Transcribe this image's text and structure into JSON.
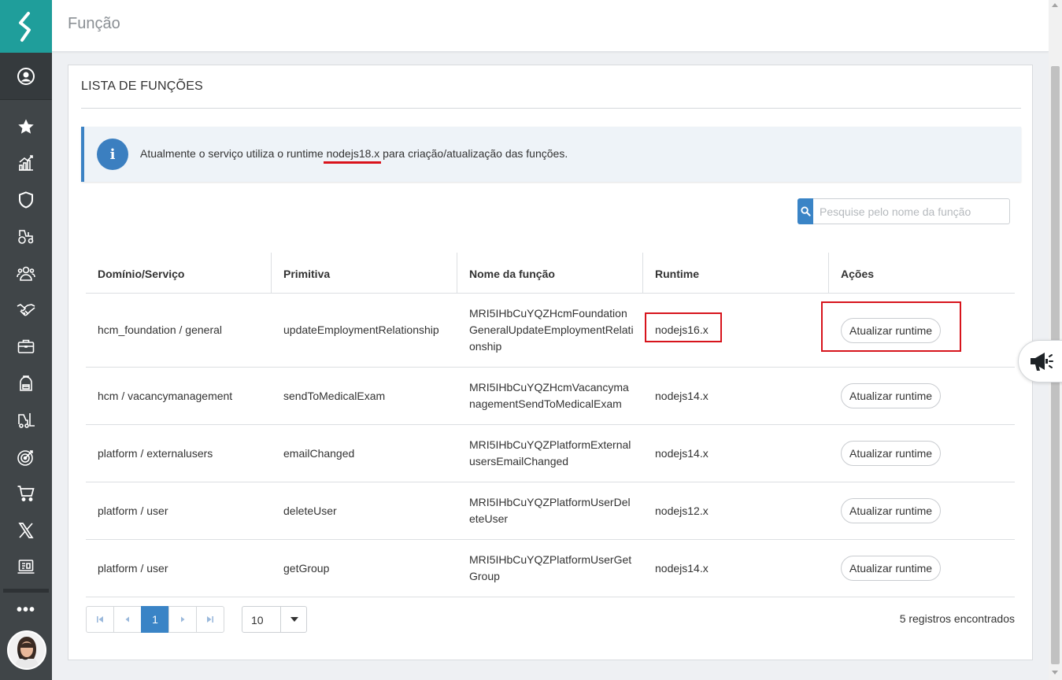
{
  "header": {
    "title": "Função"
  },
  "sidebar": {
    "items": [
      {
        "icon": "star-icon"
      },
      {
        "icon": "chart-icon"
      },
      {
        "icon": "shield-icon"
      },
      {
        "icon": "tractor-icon"
      },
      {
        "icon": "people-icon"
      },
      {
        "icon": "handshake-icon"
      },
      {
        "icon": "briefcase-icon"
      },
      {
        "icon": "backpack-icon"
      },
      {
        "icon": "forklift-icon"
      },
      {
        "icon": "target-icon"
      },
      {
        "icon": "cart-icon"
      },
      {
        "icon": "x-icon"
      },
      {
        "icon": "laptop-icon"
      }
    ],
    "more_label": "•••"
  },
  "card": {
    "title": "LISTA DE FUNÇÕES",
    "alert": {
      "text_before": "Atualmente o serviço utiliza o runtime",
      "runtime": "nodejs18.x",
      "text_after": "para criação/atualização das funções."
    },
    "search": {
      "placeholder": "Pesquise pelo nome da função"
    }
  },
  "table": {
    "headers": [
      "Domínio/Serviço",
      "Primitiva",
      "Nome da função",
      "Runtime",
      "Ações"
    ],
    "rows": [
      {
        "domain": "hcm_foundation / general",
        "primitive": "updateEmploymentRelationship",
        "function_name": "MRI5IHbCuYQZHcmFoundationGeneralUpdateEmploymentRelationship",
        "runtime": "nodejs16.x",
        "action": "Atualizar runtime"
      },
      {
        "domain": "hcm / vacancymanagement",
        "primitive": "sendToMedicalExam",
        "function_name": "MRI5IHbCuYQZHcmVacancymanagementSendToMedicalExam",
        "runtime": "nodejs14.x",
        "action": "Atualizar runtime"
      },
      {
        "domain": "platform / externalusers",
        "primitive": "emailChanged",
        "function_name": "MRI5IHbCuYQZPlatformExternalusersEmailChanged",
        "runtime": "nodejs14.x",
        "action": "Atualizar runtime"
      },
      {
        "domain": "platform / user",
        "primitive": "deleteUser",
        "function_name": "MRI5IHbCuYQZPlatformUserDeleteUser",
        "runtime": "nodejs12.x",
        "action": "Atualizar runtime"
      },
      {
        "domain": "platform / user",
        "primitive": "getGroup",
        "function_name": "MRI5IHbCuYQZPlatformUserGetGroup",
        "runtime": "nodejs14.x",
        "action": "Atualizar runtime"
      }
    ]
  },
  "pagination": {
    "current_page": "1",
    "page_size": "10",
    "records": "5 registros encontrados"
  },
  "colors": {
    "brand": "#1f9e9b",
    "accent": "#3a84c6",
    "highlight": "#d7141c",
    "sidebar": "#404548"
  }
}
